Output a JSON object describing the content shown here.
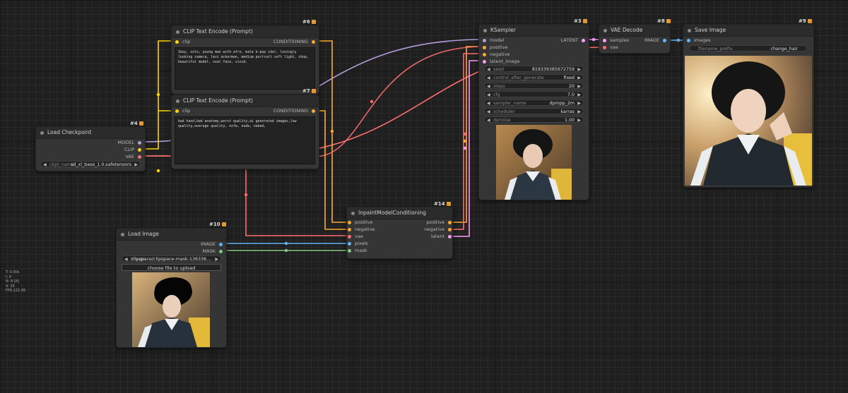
{
  "nodes": {
    "clip_pos": {
      "id": "#6",
      "title": "CLIP Text Encode (Prompt)",
      "input": "clip",
      "output": "CONDITIONING",
      "text": "1boy, solo, young man with afro, male k-pop idol, lovingly looking camera, levi ackerman, medium portrait soft light, chop, beautiful model, oval face, vivid,"
    },
    "clip_neg": {
      "id": "#7",
      "title": "CLIP Text Encode (Prompt)",
      "input": "clip",
      "output": "CONDITIONING",
      "text": "bad hand,bad anatomy,worst quality,ai generated images,low quality,average quality, nsfw, nude, naked,"
    },
    "checkpoint": {
      "id": "#4",
      "title": "Load Checkpoint",
      "outputs": [
        "MODEL",
        "CLIP",
        "VAE"
      ],
      "widget_label": "ckpt_name",
      "widget_value": "sd_xl_base_1.0.safetensors"
    },
    "ksampler": {
      "id": "#3",
      "title": "KSampler",
      "inputs": [
        "model",
        "positive",
        "negative",
        "latent_image"
      ],
      "output": "LATENT",
      "widgets": [
        {
          "label": "seed",
          "value": "819339385672759"
        },
        {
          "label": "control_after_generate",
          "value": "fixed"
        },
        {
          "label": "steps",
          "value": "20"
        },
        {
          "label": "cfg",
          "value": "7.0"
        },
        {
          "label": "sampler_name",
          "value": "dpmpp_2m"
        },
        {
          "label": "scheduler",
          "value": "karras"
        },
        {
          "label": "denoise",
          "value": "1.00"
        }
      ]
    },
    "vae_decode": {
      "id": "#8",
      "title": "VAE Decode",
      "inputs": [
        "samples",
        "vae"
      ],
      "output": "IMAGE"
    },
    "save_image": {
      "id": "#9",
      "title": "Save Image",
      "input": "images",
      "widget_label": "filename_prefix",
      "widget_value": "change_hair"
    },
    "inpaint": {
      "id": "#14",
      "title": "InpaintModelConditioning",
      "inputs": [
        "positive",
        "negative",
        "vae",
        "pixels",
        "mask"
      ],
      "outputs": [
        "positive",
        "negative",
        "latent"
      ]
    },
    "load_image": {
      "id": "#10",
      "title": "Load Image",
      "outputs": [
        "IMAGE",
        "MASK"
      ],
      "widget_label": "image",
      "widget_value": "clipspace/clipspace-mask-136336....",
      "upload_label": "choose file to upload"
    }
  },
  "stats": [
    "T: 0.00s",
    "I: 0",
    "N: 8 [8]",
    "V: 35",
    "FPS:121.95"
  ],
  "colors": {
    "model": "#b39ddb",
    "clip": "#ffd500",
    "vae": "#ff6e6e",
    "conditioning": "#ffa931",
    "latent": "#ff9cf9",
    "image": "#64b5f6",
    "mask": "#81c784"
  }
}
